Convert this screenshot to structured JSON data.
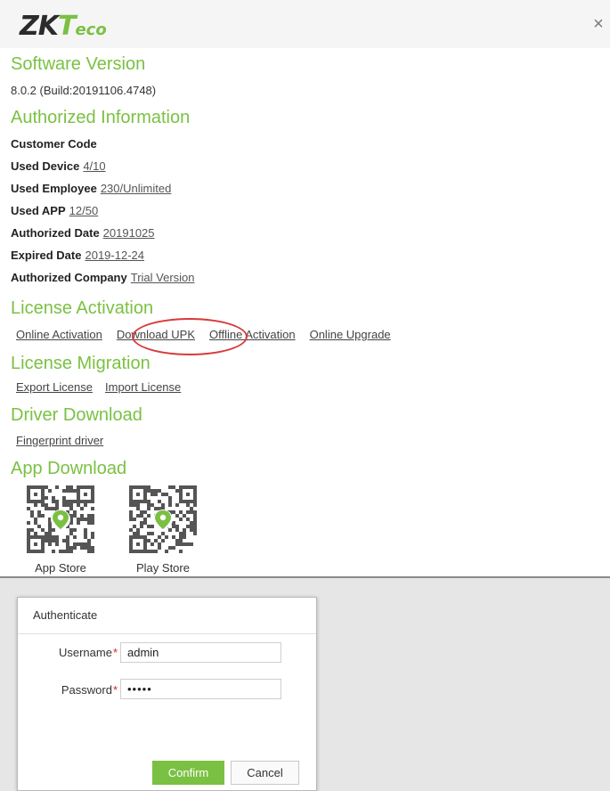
{
  "about": {
    "logo": {
      "zk": "ZK",
      "t": "T",
      "eco": "eco"
    },
    "close_symbol": "×",
    "software_version": {
      "title": "Software Version",
      "value": "8.0.2 (Build:20191106.4748)"
    },
    "authorized_information": {
      "title": "Authorized Information",
      "customer_code_label": "Customer Code",
      "rows": [
        {
          "label": "Used Device",
          "value": "4/10"
        },
        {
          "label": "Used Employee",
          "value": "230/Unlimited"
        },
        {
          "label": "Used APP",
          "value": "12/50"
        },
        {
          "label": "Authorized Date",
          "value": "20191025"
        },
        {
          "label": "Expired Date",
          "value": "2019-12-24"
        },
        {
          "label": "Authorized Company",
          "value": "Trial Version"
        }
      ]
    },
    "license_activation": {
      "title": "License Activation",
      "links": [
        "Online Activation",
        "Download UPK",
        "Offline Activation",
        "Online Upgrade"
      ]
    },
    "license_migration": {
      "title": "License Migration",
      "links": [
        "Export License",
        "Import License"
      ]
    },
    "driver_download": {
      "title": "Driver Download",
      "links": [
        "Fingerprint driver"
      ]
    },
    "app_download": {
      "title": "App Download",
      "items": [
        {
          "label": "App Store",
          "icon": "qr-code-icon"
        },
        {
          "label": "Play Store",
          "icon": "qr-code-icon"
        }
      ]
    },
    "highlight_color": "#d83a3a",
    "accent_color": "#7ac143"
  },
  "auth": {
    "title": "Authenticate",
    "username_label": "Username",
    "username_value": "admin",
    "password_label": "Password",
    "password_value": "•••••",
    "required_mark": "*",
    "confirm_label": "Confirm",
    "cancel_label": "Cancel"
  }
}
